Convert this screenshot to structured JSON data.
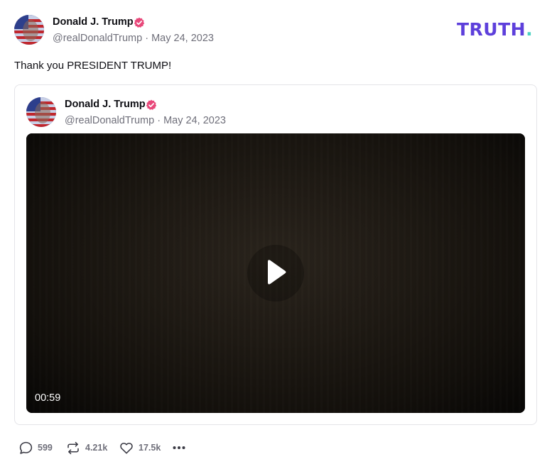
{
  "post": {
    "author_name": "Donald J. Trump",
    "handle_date": "@realDonaldTrump · May 24, 2023",
    "text": "Thank you PRESIDENT TRUMP!"
  },
  "logo": {
    "text": "TRUTH",
    "dot": "."
  },
  "quoted_post": {
    "author_name": "Donald J. Trump",
    "handle_date": "@realDonaldTrump · May 24, 2023",
    "video": {
      "duration": "00:59"
    }
  },
  "actions": {
    "replies": "599",
    "retruths": "4.21k",
    "likes": "17.5k"
  },
  "colors": {
    "brand_purple": "#5d3fdb",
    "brand_teal": "#4cd3c2",
    "verified_pink": "#e8487a",
    "muted_text": "#6f6f7a"
  },
  "icons": {
    "verified": "verified-badge-icon",
    "reply": "speech-bubble-icon",
    "retruth": "repost-arrows-icon",
    "like": "heart-icon",
    "more": "ellipsis-icon",
    "play": "play-icon"
  }
}
